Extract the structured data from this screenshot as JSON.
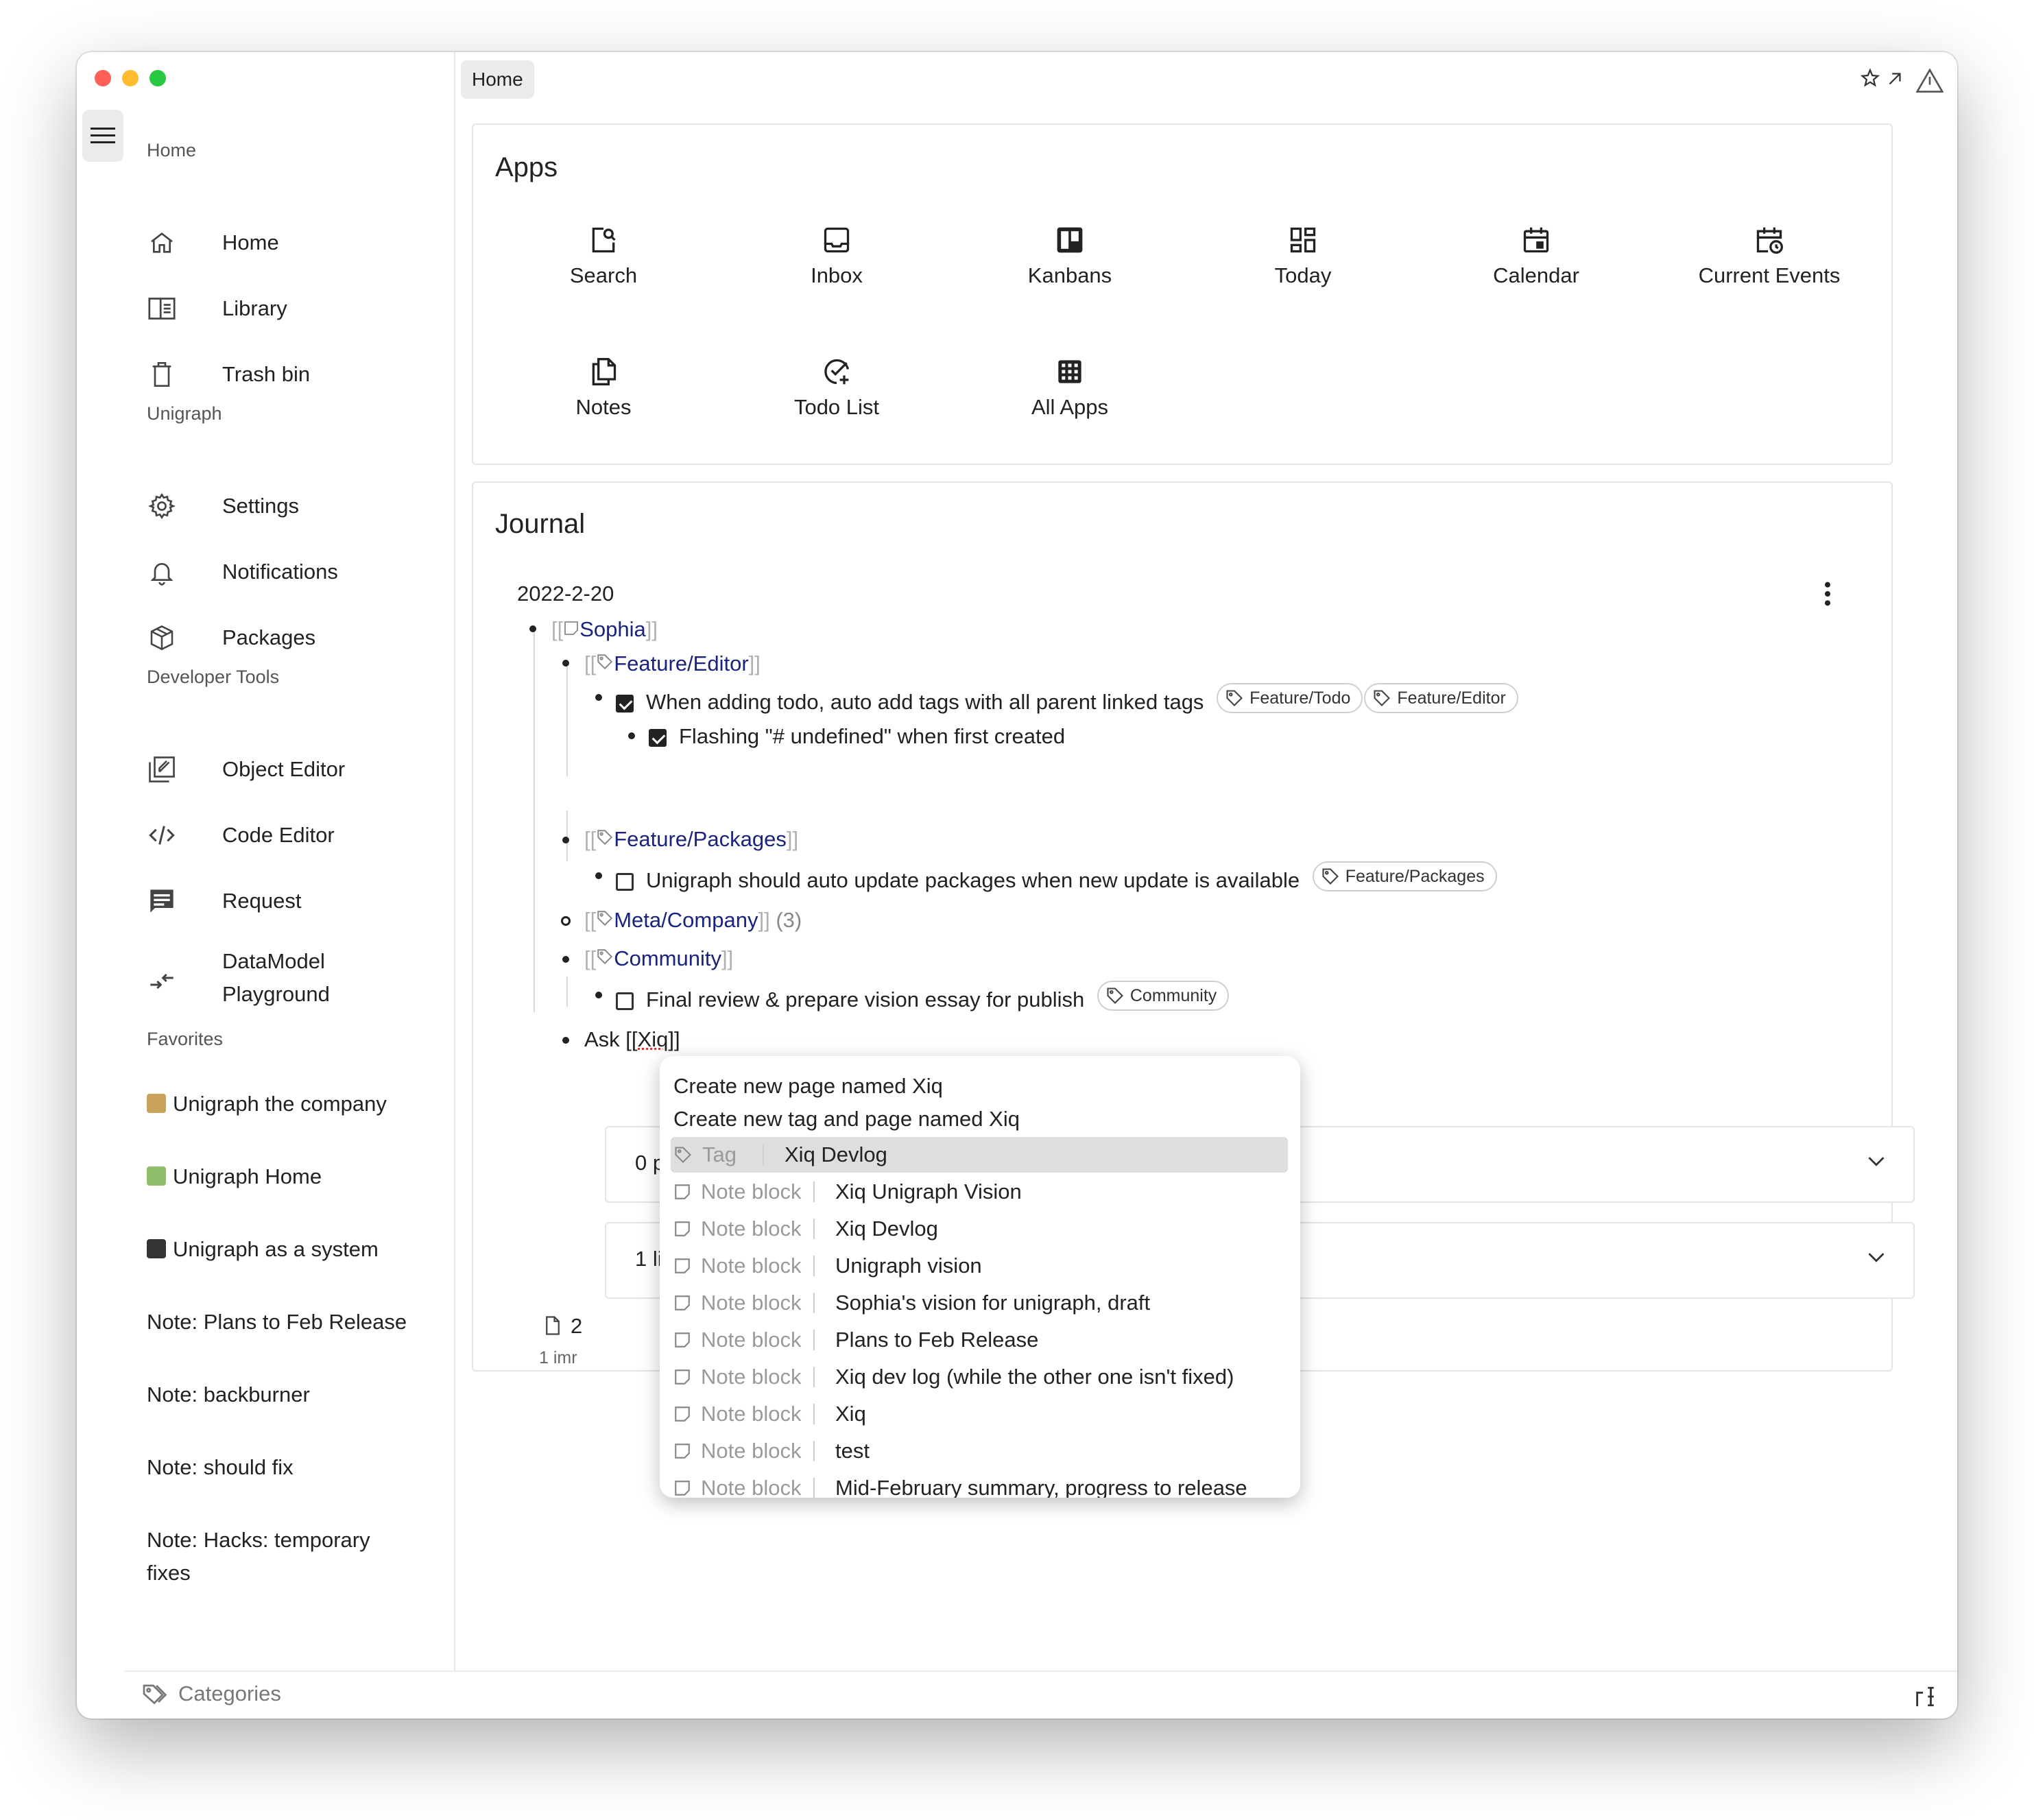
{
  "tab": {
    "title": "Home"
  },
  "sidebar": {
    "sections": [
      "Home",
      "Unigraph",
      "Developer Tools",
      "Favorites"
    ],
    "home_items": [
      {
        "label": "Home",
        "icon": "home-icon"
      },
      {
        "label": "Library",
        "icon": "library-icon"
      },
      {
        "label": "Trash bin",
        "icon": "trash-icon"
      }
    ],
    "unigraph_items": [
      {
        "label": "Settings",
        "icon": "gear-icon"
      },
      {
        "label": "Notifications",
        "icon": "bell-icon"
      },
      {
        "label": "Packages",
        "icon": "package-icon"
      }
    ],
    "dev_items": [
      {
        "label": "Object Editor",
        "icon": "object-editor-icon"
      },
      {
        "label": "Code Editor",
        "icon": "code-icon"
      },
      {
        "label": "Request",
        "icon": "request-icon"
      },
      {
        "label": "DataModel",
        "label2": "Playground",
        "icon": "compare-arrows-icon"
      }
    ],
    "favorites": [
      "Unigraph the company",
      "Unigraph Home",
      "Unigraph as a system",
      "Note: Plans to Feb Release",
      "Note: backburner",
      "Note: should fix",
      "Note: Hacks: temporary",
      "fixes"
    ]
  },
  "apps": {
    "title": "Apps",
    "items": [
      "Search",
      "Inbox",
      "Kanbans",
      "Today",
      "Calendar",
      "Current Events",
      "Notes",
      "Todo List",
      "All Apps"
    ]
  },
  "journal": {
    "title": "Journal",
    "date": "2022-2-20",
    "open": "[[",
    "close": "]]",
    "sophia": "Sophia",
    "feature_editor": "Feature/Editor",
    "todo1": "When adding todo, auto add tags with all parent linked tags",
    "chip_todo": "Feature/Todo",
    "chip_editor": "Feature/Editor",
    "todo1_child": "Flashing \"# undefined\" when first created",
    "feature_packages": "Feature/Packages",
    "todo2": "Unigraph should auto update packages when new update is available",
    "chip_packages": "Feature/Packages",
    "meta_company": "Meta/Company",
    "meta_count": "(3)",
    "community": "Community",
    "todo3": "Final review & prepare vision essay for publish",
    "chip_community": "Community",
    "ask_prefix": "Ask ",
    "ask_link": "[[Xiq]]",
    "collapsed1": "0 p",
    "collapsed2": "1 li",
    "count_line": "2",
    "small_line": "1 imr"
  },
  "popup": {
    "action1": "Create new page named Xiq",
    "action2": "Create new tag and page named Xiq",
    "rows": [
      {
        "type": "Tag",
        "title": "Xiq Devlog"
      },
      {
        "type": "Note block",
        "title": "Xiq Unigraph Vision"
      },
      {
        "type": "Note block",
        "title": "Xiq Devlog"
      },
      {
        "type": "Note block",
        "title": "Unigraph vision"
      },
      {
        "type": "Note block",
        "title": "Sophia's vision for unigraph, draft"
      },
      {
        "type": "Note block",
        "title": "Plans to Feb Release"
      },
      {
        "type": "Note block",
        "title": "Xiq dev log (while the other one isn't fixed)"
      },
      {
        "type": "Note block",
        "title": "Xiq"
      },
      {
        "type": "Note block",
        "title": "test"
      },
      {
        "type": "Note block",
        "title": "Mid-February summary, progress to release"
      }
    ]
  },
  "footer": {
    "categories": "Categories"
  },
  "colors": {
    "link": "#1a237e",
    "close": "#ff5f57",
    "minimize": "#febc2e",
    "zoom": "#28c840"
  }
}
